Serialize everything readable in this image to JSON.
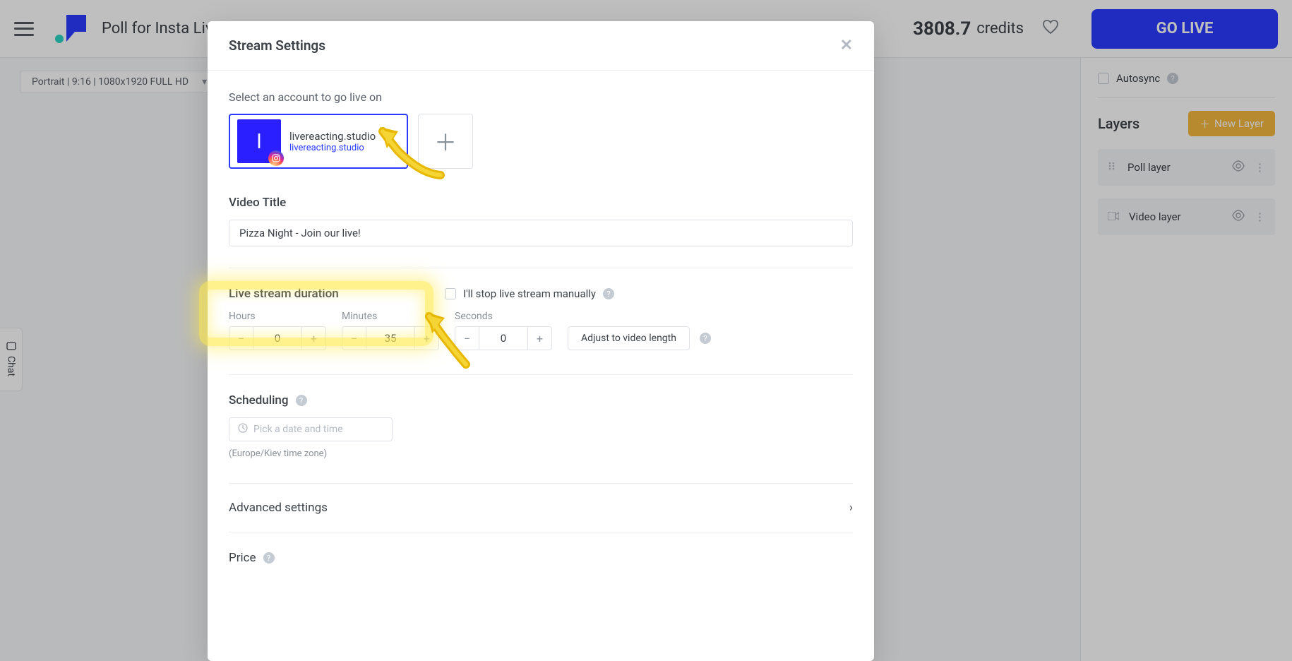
{
  "header": {
    "title": "Poll for Insta Live",
    "credits_value": "3808.7",
    "credits_label": "credits",
    "go_live_label": "GO LIVE"
  },
  "canvas": {
    "format_label": "Portrait | 9:16 | 1080x1920 FULL HD",
    "chat_label": "Chat"
  },
  "right_panel": {
    "autosync_label": "Autosync",
    "layers_heading": "Layers",
    "new_layer_label": "New Layer",
    "layers": [
      {
        "name": "Poll layer"
      },
      {
        "name": "Video layer"
      }
    ]
  },
  "modal": {
    "title": "Stream Settings",
    "select_account_label": "Select an account to go live on",
    "account": {
      "avatar_letter": "l",
      "name": "livereacting.studio",
      "subname": "livereacting.studio"
    },
    "video_title_label": "Video Title",
    "video_title_value": "Pizza Night - Join our live!",
    "duration_label": "Live stream duration",
    "stop_manual_label": "I'll stop live stream manually",
    "hours_label": "Hours",
    "hours_value": "0",
    "minutes_label": "Minutes",
    "minutes_value": "35",
    "seconds_label": "Seconds",
    "seconds_value": "0",
    "adjust_label": "Adjust to video length",
    "scheduling_label": "Scheduling",
    "date_placeholder": "Pick a date and time",
    "tz_note": "(Europe/Kiev time zone)",
    "advanced_label": "Advanced settings",
    "price_label": "Price"
  }
}
